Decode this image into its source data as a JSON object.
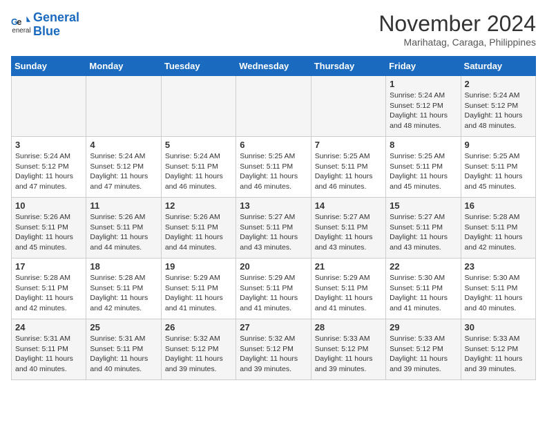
{
  "header": {
    "logo_line1": "General",
    "logo_line2": "Blue",
    "month": "November 2024",
    "location": "Marihatag, Caraga, Philippines"
  },
  "days_of_week": [
    "Sunday",
    "Monday",
    "Tuesday",
    "Wednesday",
    "Thursday",
    "Friday",
    "Saturday"
  ],
  "weeks": [
    [
      {
        "day": "",
        "info": ""
      },
      {
        "day": "",
        "info": ""
      },
      {
        "day": "",
        "info": ""
      },
      {
        "day": "",
        "info": ""
      },
      {
        "day": "",
        "info": ""
      },
      {
        "day": "1",
        "info": "Sunrise: 5:24 AM\nSunset: 5:12 PM\nDaylight: 11 hours\nand 48 minutes."
      },
      {
        "day": "2",
        "info": "Sunrise: 5:24 AM\nSunset: 5:12 PM\nDaylight: 11 hours\nand 48 minutes."
      }
    ],
    [
      {
        "day": "3",
        "info": "Sunrise: 5:24 AM\nSunset: 5:12 PM\nDaylight: 11 hours\nand 47 minutes."
      },
      {
        "day": "4",
        "info": "Sunrise: 5:24 AM\nSunset: 5:12 PM\nDaylight: 11 hours\nand 47 minutes."
      },
      {
        "day": "5",
        "info": "Sunrise: 5:24 AM\nSunset: 5:11 PM\nDaylight: 11 hours\nand 46 minutes."
      },
      {
        "day": "6",
        "info": "Sunrise: 5:25 AM\nSunset: 5:11 PM\nDaylight: 11 hours\nand 46 minutes."
      },
      {
        "day": "7",
        "info": "Sunrise: 5:25 AM\nSunset: 5:11 PM\nDaylight: 11 hours\nand 46 minutes."
      },
      {
        "day": "8",
        "info": "Sunrise: 5:25 AM\nSunset: 5:11 PM\nDaylight: 11 hours\nand 45 minutes."
      },
      {
        "day": "9",
        "info": "Sunrise: 5:25 AM\nSunset: 5:11 PM\nDaylight: 11 hours\nand 45 minutes."
      }
    ],
    [
      {
        "day": "10",
        "info": "Sunrise: 5:26 AM\nSunset: 5:11 PM\nDaylight: 11 hours\nand 45 minutes."
      },
      {
        "day": "11",
        "info": "Sunrise: 5:26 AM\nSunset: 5:11 PM\nDaylight: 11 hours\nand 44 minutes."
      },
      {
        "day": "12",
        "info": "Sunrise: 5:26 AM\nSunset: 5:11 PM\nDaylight: 11 hours\nand 44 minutes."
      },
      {
        "day": "13",
        "info": "Sunrise: 5:27 AM\nSunset: 5:11 PM\nDaylight: 11 hours\nand 43 minutes."
      },
      {
        "day": "14",
        "info": "Sunrise: 5:27 AM\nSunset: 5:11 PM\nDaylight: 11 hours\nand 43 minutes."
      },
      {
        "day": "15",
        "info": "Sunrise: 5:27 AM\nSunset: 5:11 PM\nDaylight: 11 hours\nand 43 minutes."
      },
      {
        "day": "16",
        "info": "Sunrise: 5:28 AM\nSunset: 5:11 PM\nDaylight: 11 hours\nand 42 minutes."
      }
    ],
    [
      {
        "day": "17",
        "info": "Sunrise: 5:28 AM\nSunset: 5:11 PM\nDaylight: 11 hours\nand 42 minutes."
      },
      {
        "day": "18",
        "info": "Sunrise: 5:28 AM\nSunset: 5:11 PM\nDaylight: 11 hours\nand 42 minutes."
      },
      {
        "day": "19",
        "info": "Sunrise: 5:29 AM\nSunset: 5:11 PM\nDaylight: 11 hours\nand 41 minutes."
      },
      {
        "day": "20",
        "info": "Sunrise: 5:29 AM\nSunset: 5:11 PM\nDaylight: 11 hours\nand 41 minutes."
      },
      {
        "day": "21",
        "info": "Sunrise: 5:29 AM\nSunset: 5:11 PM\nDaylight: 11 hours\nand 41 minutes."
      },
      {
        "day": "22",
        "info": "Sunrise: 5:30 AM\nSunset: 5:11 PM\nDaylight: 11 hours\nand 41 minutes."
      },
      {
        "day": "23",
        "info": "Sunrise: 5:30 AM\nSunset: 5:11 PM\nDaylight: 11 hours\nand 40 minutes."
      }
    ],
    [
      {
        "day": "24",
        "info": "Sunrise: 5:31 AM\nSunset: 5:11 PM\nDaylight: 11 hours\nand 40 minutes."
      },
      {
        "day": "25",
        "info": "Sunrise: 5:31 AM\nSunset: 5:11 PM\nDaylight: 11 hours\nand 40 minutes."
      },
      {
        "day": "26",
        "info": "Sunrise: 5:32 AM\nSunset: 5:12 PM\nDaylight: 11 hours\nand 39 minutes."
      },
      {
        "day": "27",
        "info": "Sunrise: 5:32 AM\nSunset: 5:12 PM\nDaylight: 11 hours\nand 39 minutes."
      },
      {
        "day": "28",
        "info": "Sunrise: 5:33 AM\nSunset: 5:12 PM\nDaylight: 11 hours\nand 39 minutes."
      },
      {
        "day": "29",
        "info": "Sunrise: 5:33 AM\nSunset: 5:12 PM\nDaylight: 11 hours\nand 39 minutes."
      },
      {
        "day": "30",
        "info": "Sunrise: 5:33 AM\nSunset: 5:12 PM\nDaylight: 11 hours\nand 39 minutes."
      }
    ]
  ]
}
